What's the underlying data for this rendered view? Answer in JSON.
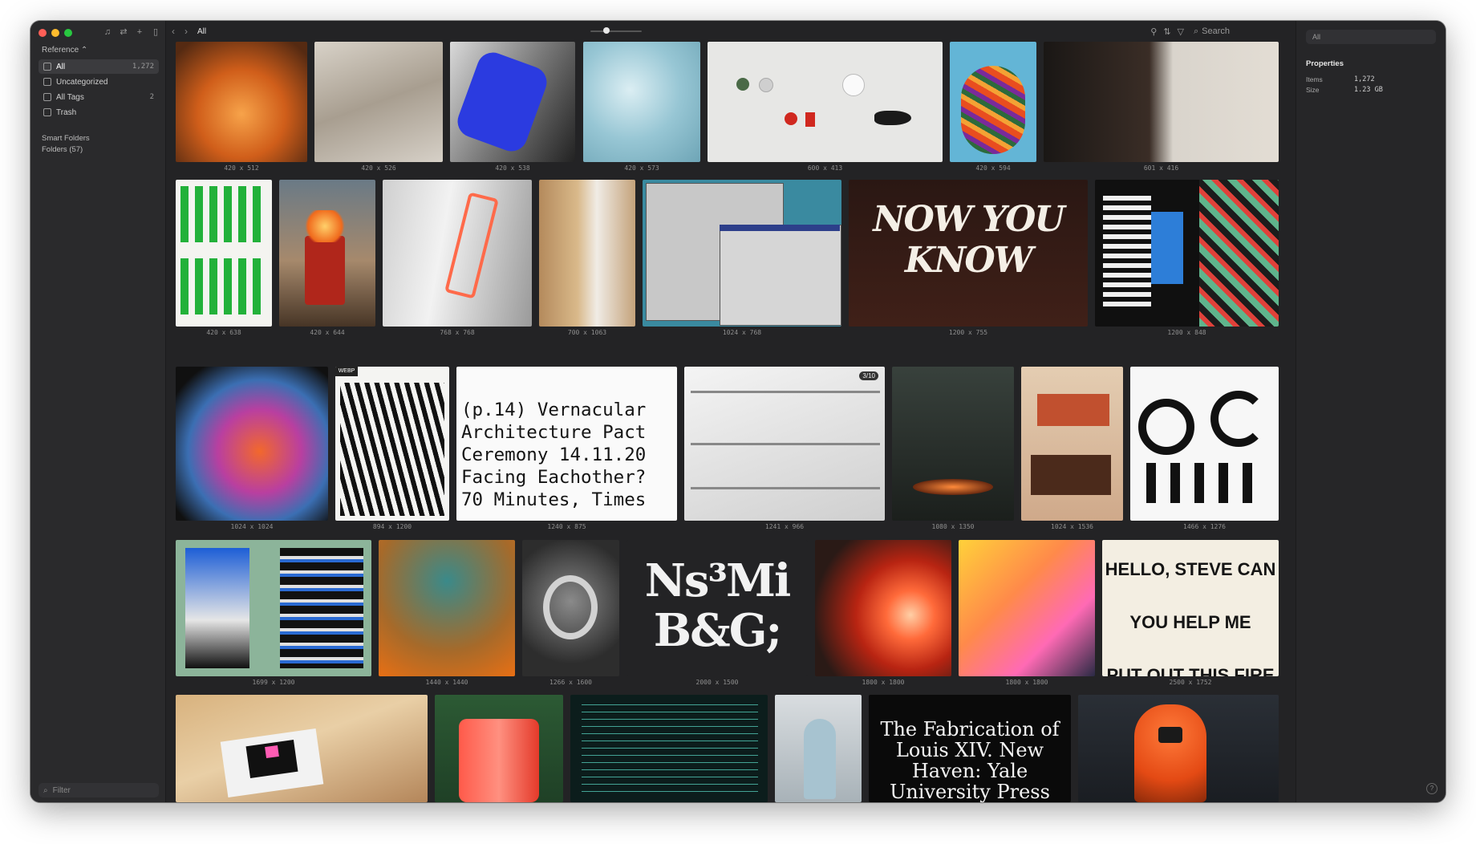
{
  "window": {
    "title": "All"
  },
  "sidebar": {
    "library_label": "Reference",
    "items": [
      {
        "label": "All",
        "count": "1,272"
      },
      {
        "label": "Uncategorized",
        "count": ""
      },
      {
        "label": "All Tags",
        "count": "2"
      },
      {
        "label": "Trash",
        "count": ""
      }
    ],
    "smart_folders": "Smart Folders",
    "folders": "Folders (57)",
    "filter_placeholder": "Filter"
  },
  "toolbar": {
    "title": "All",
    "search_placeholder": "Search"
  },
  "inspector": {
    "search_value": "All",
    "section_title": "Properties",
    "items_label": "Items",
    "items_value": "1,272",
    "size_label": "Size",
    "size_value": "1.23 GB"
  },
  "tiles": {
    "r1": [
      "420 x 512",
      "420 x 526",
      "420 x 538",
      "420 x 573",
      "600 x 413",
      "420 x 594",
      "601 x 416"
    ],
    "r2": [
      "420 x 638",
      "420 x 644",
      "768 x 768",
      "700 x 1063",
      "1024 x 768",
      "1200 x 755",
      "1200 x 848"
    ],
    "r3": [
      "1024 x 1024",
      "894 x 1200",
      "1240 x 875",
      "1241 x 966",
      "1080 x 1350",
      "1024 x 1536",
      "1466 x 1276"
    ],
    "r4": [
      "1699 x 1200",
      "1440 x 1440",
      "1266 x 1600",
      "2000 x 1500",
      "1800 x 1800",
      "1800 x 1800",
      "2500 x 1752"
    ]
  },
  "art_text": {
    "vernacular": [
      "(p.14) Vernacular",
      "Architecture Pact",
      "Ceremony 14.11.20",
      "Facing Eachother?",
      "70 Minutes, Times"
    ],
    "nowyouknow": "NOW YOU KNOW",
    "nsmi": [
      "Ns³Mi",
      "B&G;"
    ],
    "hello": [
      "HELLO, STEVE CAN",
      "YOU HELP ME",
      "PUT OUT THIS FIRE"
    ],
    "fabrication": [
      "The Fabrication of",
      "Louis XIV. New",
      "Haven: Yale",
      "University Press"
    ],
    "badge_310": "3/10",
    "webp_badge": "WEBP"
  }
}
